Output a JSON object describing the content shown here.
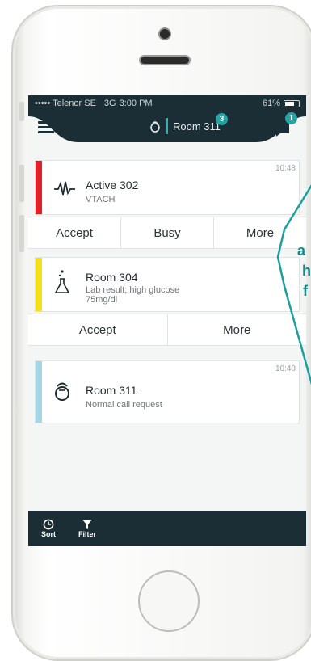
{
  "status": {
    "carrier": "••••• Telenor SE",
    "network": "3G",
    "time": "3:00 PM",
    "battery": "61%"
  },
  "nav": {
    "room": "Room 311",
    "room_badge": "3",
    "chat_badge": "1"
  },
  "alerts": [
    {
      "title": "Active 302",
      "subtitle": "VTACH",
      "time": "10:48",
      "stripe_color": "#e0202a",
      "icon": "ecg-wave-icon"
    },
    {
      "title": "Room 304",
      "subtitle_line1": "Lab result; high glucose",
      "subtitle_line2": "75mg/dl",
      "time": "",
      "stripe_color": "#f2e11a",
      "icon": "flask-icon"
    },
    {
      "title": "Room 311",
      "subtitle": "Normal call request",
      "time": "10:48",
      "stripe_color": "#a6d6e6",
      "icon": "nurse-call-icon"
    }
  ],
  "actions1": {
    "accept": "Accept",
    "busy": "Busy",
    "more": "More"
  },
  "actions2": {
    "accept": "Accept",
    "more": "More"
  },
  "tabs": {
    "sort": "Sort",
    "filter": "Filter"
  },
  "callout": {
    "line1": "a",
    "line2": "h",
    "line3": "f"
  },
  "colors": {
    "navy": "#1b2e35",
    "teal": "#21a8a6"
  }
}
